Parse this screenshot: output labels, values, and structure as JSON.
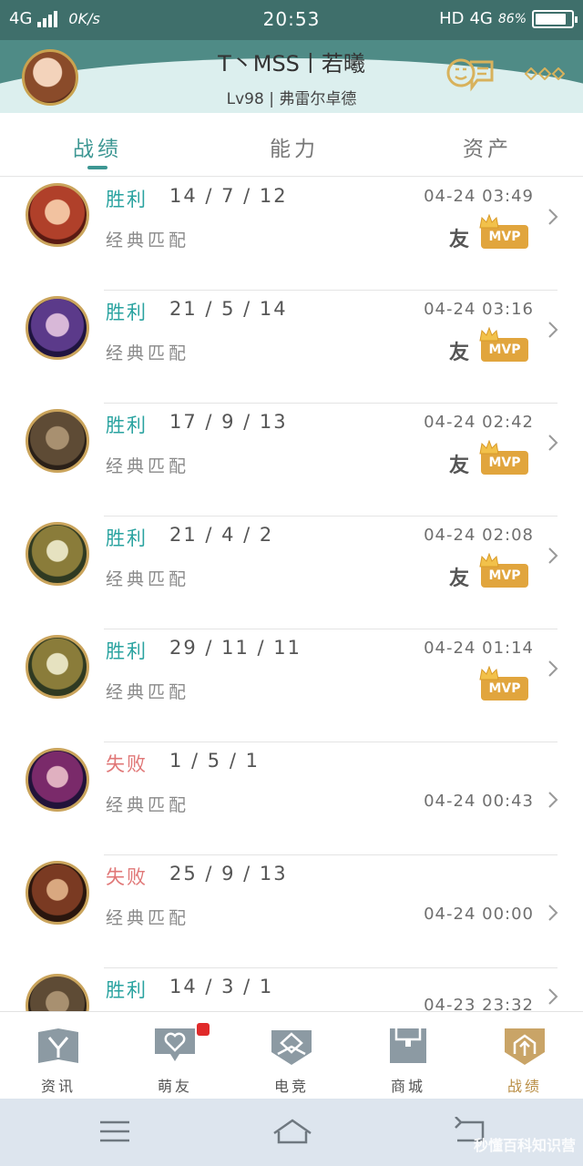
{
  "status_bar": {
    "network": "4G",
    "speed": "0K/s",
    "time": "20:53",
    "hd": "HD",
    "network_right": "4G",
    "battery": "86%",
    "battery_level": 0.86
  },
  "profile": {
    "nickname": "T丶MSS丨若曦",
    "subline": "Lv98 | 弗雷尔卓德"
  },
  "tabs": [
    {
      "label": "战绩",
      "active": true
    },
    {
      "label": "能力",
      "active": false
    },
    {
      "label": "资产",
      "active": false
    }
  ],
  "matches": [
    {
      "result": "胜利",
      "kda": "14 / 7 / 12",
      "mode": "经典匹配",
      "time": "04-24 03:49",
      "friend": "友",
      "mvp": "MVP",
      "outcome": "win"
    },
    {
      "result": "胜利",
      "kda": "21 / 5 / 14",
      "mode": "经典匹配",
      "time": "04-24 03:16",
      "friend": "友",
      "mvp": "MVP",
      "outcome": "win"
    },
    {
      "result": "胜利",
      "kda": "17 / 9 / 13",
      "mode": "经典匹配",
      "time": "04-24 02:42",
      "friend": "友",
      "mvp": "MVP",
      "outcome": "win"
    },
    {
      "result": "胜利",
      "kda": "21 / 4 / 2",
      "mode": "经典匹配",
      "time": "04-24 02:08",
      "friend": "友",
      "mvp": "MVP",
      "outcome": "win"
    },
    {
      "result": "胜利",
      "kda": "29 / 11 / 11",
      "mode": "经典匹配",
      "time": "04-24 01:14",
      "friend": "",
      "mvp": "MVP",
      "outcome": "win"
    },
    {
      "result": "失败",
      "kda": "1 / 5 / 1",
      "mode": "经典匹配",
      "time": "04-24 00:43",
      "friend": "",
      "mvp": "",
      "outcome": "lose"
    },
    {
      "result": "失败",
      "kda": "25 / 9 / 13",
      "mode": "经典匹配",
      "time": "04-24 00:00",
      "friend": "",
      "mvp": "",
      "outcome": "lose"
    },
    {
      "result": "胜利",
      "kda": "14 / 3 / 1",
      "mode": "",
      "time": "04-23 23:32",
      "friend": "",
      "mvp": "",
      "outcome": "win"
    }
  ],
  "bottom_nav": [
    {
      "label": "资讯",
      "icon": "news-icon"
    },
    {
      "label": "萌友",
      "icon": "friends-chat-icon"
    },
    {
      "label": "电竞",
      "icon": "esports-icon"
    },
    {
      "label": "商城",
      "icon": "store-icon"
    },
    {
      "label": "战绩",
      "icon": "record-icon"
    }
  ],
  "watermark": "秒懂百科知识营",
  "colors": {
    "accent": "#3d9793",
    "win": "#2aa3a0",
    "lose": "#e07777",
    "mvp": "#e1a53d",
    "nav_active": "#b98e45",
    "header_teal": "#4f8b86"
  }
}
